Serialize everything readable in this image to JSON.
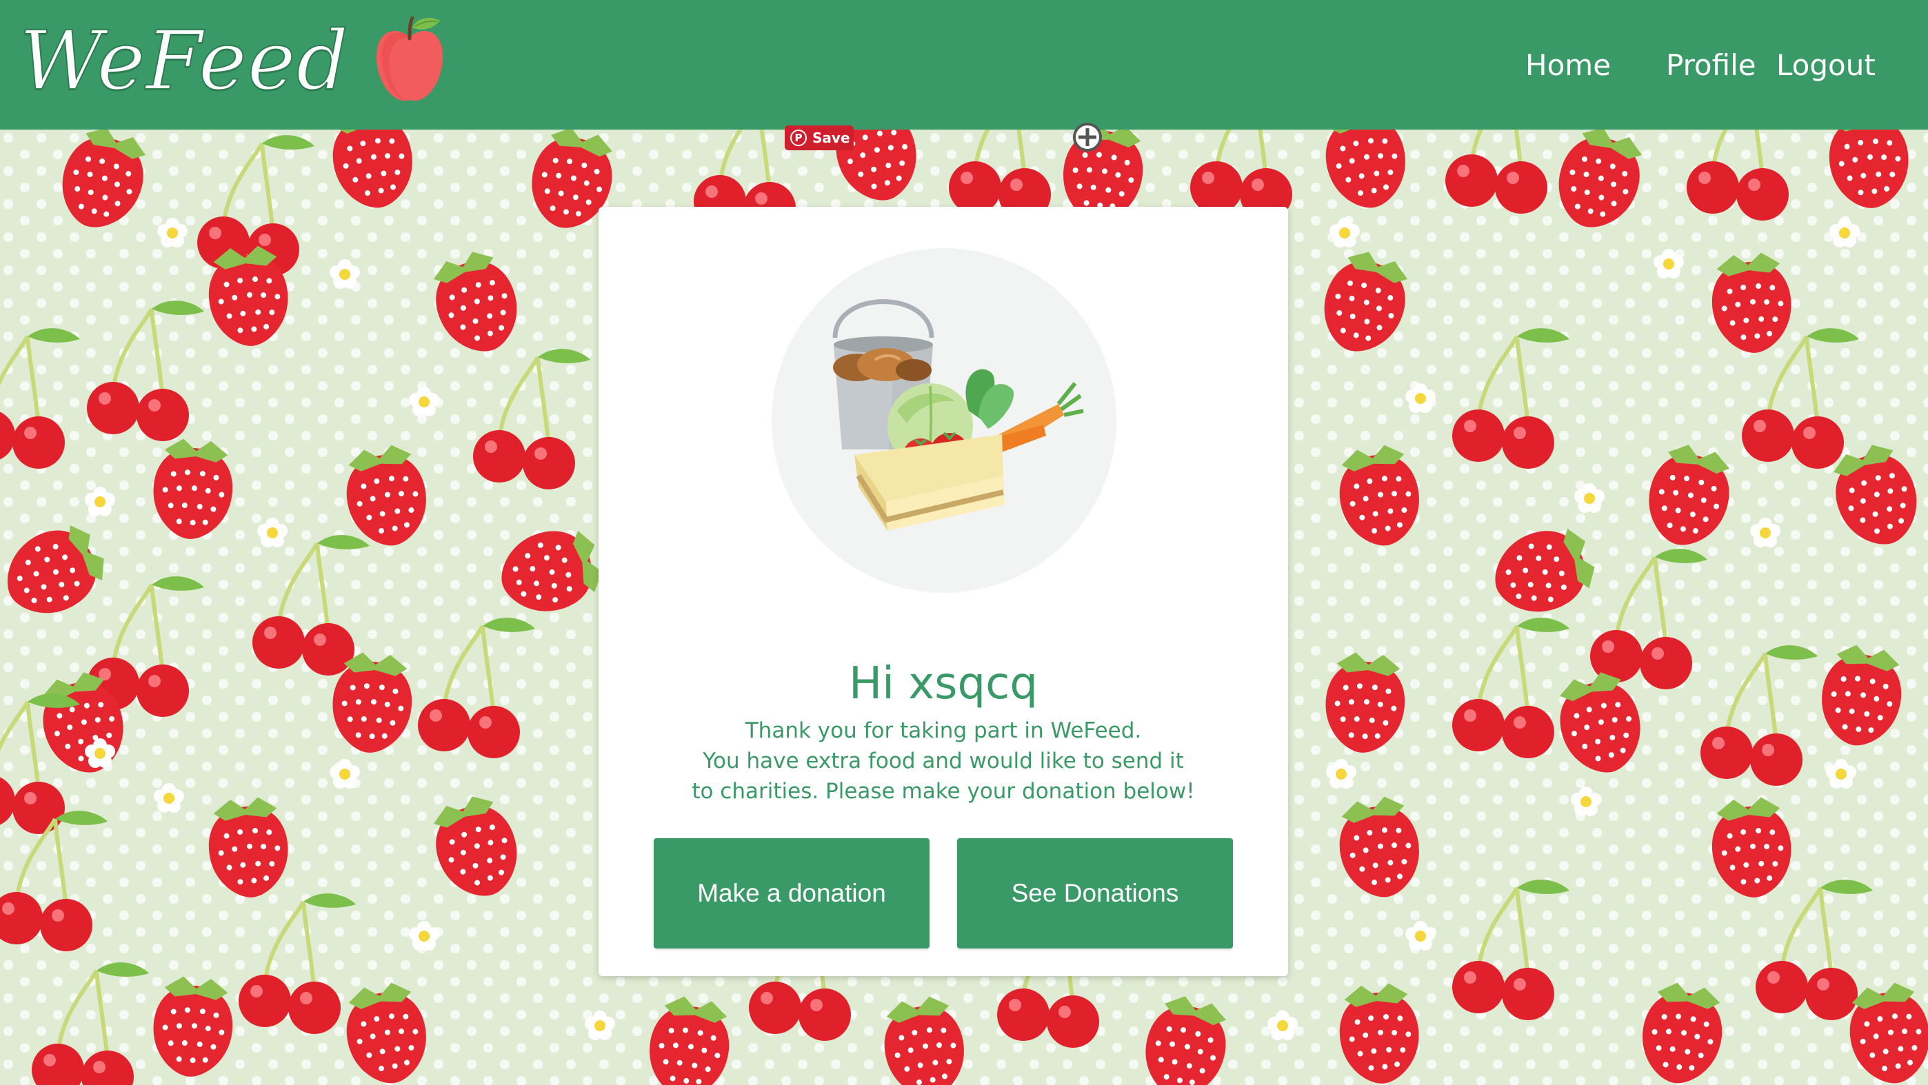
{
  "header": {
    "app_name": "WeFeed",
    "logo_icon": "apple-icon",
    "nav": {
      "home": "Home",
      "profile": "Profile",
      "logout": "Logout"
    }
  },
  "overlay": {
    "pin_save_label": "Save",
    "pin_icon": "pinterest-icon",
    "crosshair_icon": "crosshair-icon"
  },
  "card": {
    "illustration_icon": "food-basket-icon",
    "greeting": "Hi xsqcq",
    "message_lines": [
      "Thank you for taking part in WeFeed.",
      "You have extra food and would like to send it",
      "to charities. Please make your donation below!"
    ],
    "buttons": {
      "make_donation": "Make a donation",
      "see_donations": "See Donations"
    }
  },
  "colors": {
    "brand_green": "#3a9a67",
    "background": "#dfecd3",
    "card_bg": "#ffffff",
    "pinterest_red": "#cf1f2d"
  }
}
